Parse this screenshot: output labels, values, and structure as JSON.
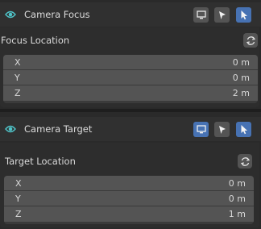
{
  "accent_color": "#4fc3c8",
  "panels": [
    {
      "title": "Camera Focus",
      "icons": [
        "display-icon",
        "cursor-arrow-icon",
        "pointer-select-icon"
      ],
      "section_label": "Focus Location",
      "rows": [
        {
          "axis": "X",
          "value": "0 m"
        },
        {
          "axis": "Y",
          "value": "0 m"
        },
        {
          "axis": "Z",
          "value": "2 m"
        }
      ]
    },
    {
      "title": "Camera Target",
      "icons": [
        "display-icon",
        "cursor-arrow-icon",
        "pointer-select-icon"
      ],
      "section_label": "Target Location",
      "rows": [
        {
          "axis": "X",
          "value": "0 m"
        },
        {
          "axis": "Y",
          "value": "0 m"
        },
        {
          "axis": "Z",
          "value": "1 m"
        }
      ]
    }
  ]
}
